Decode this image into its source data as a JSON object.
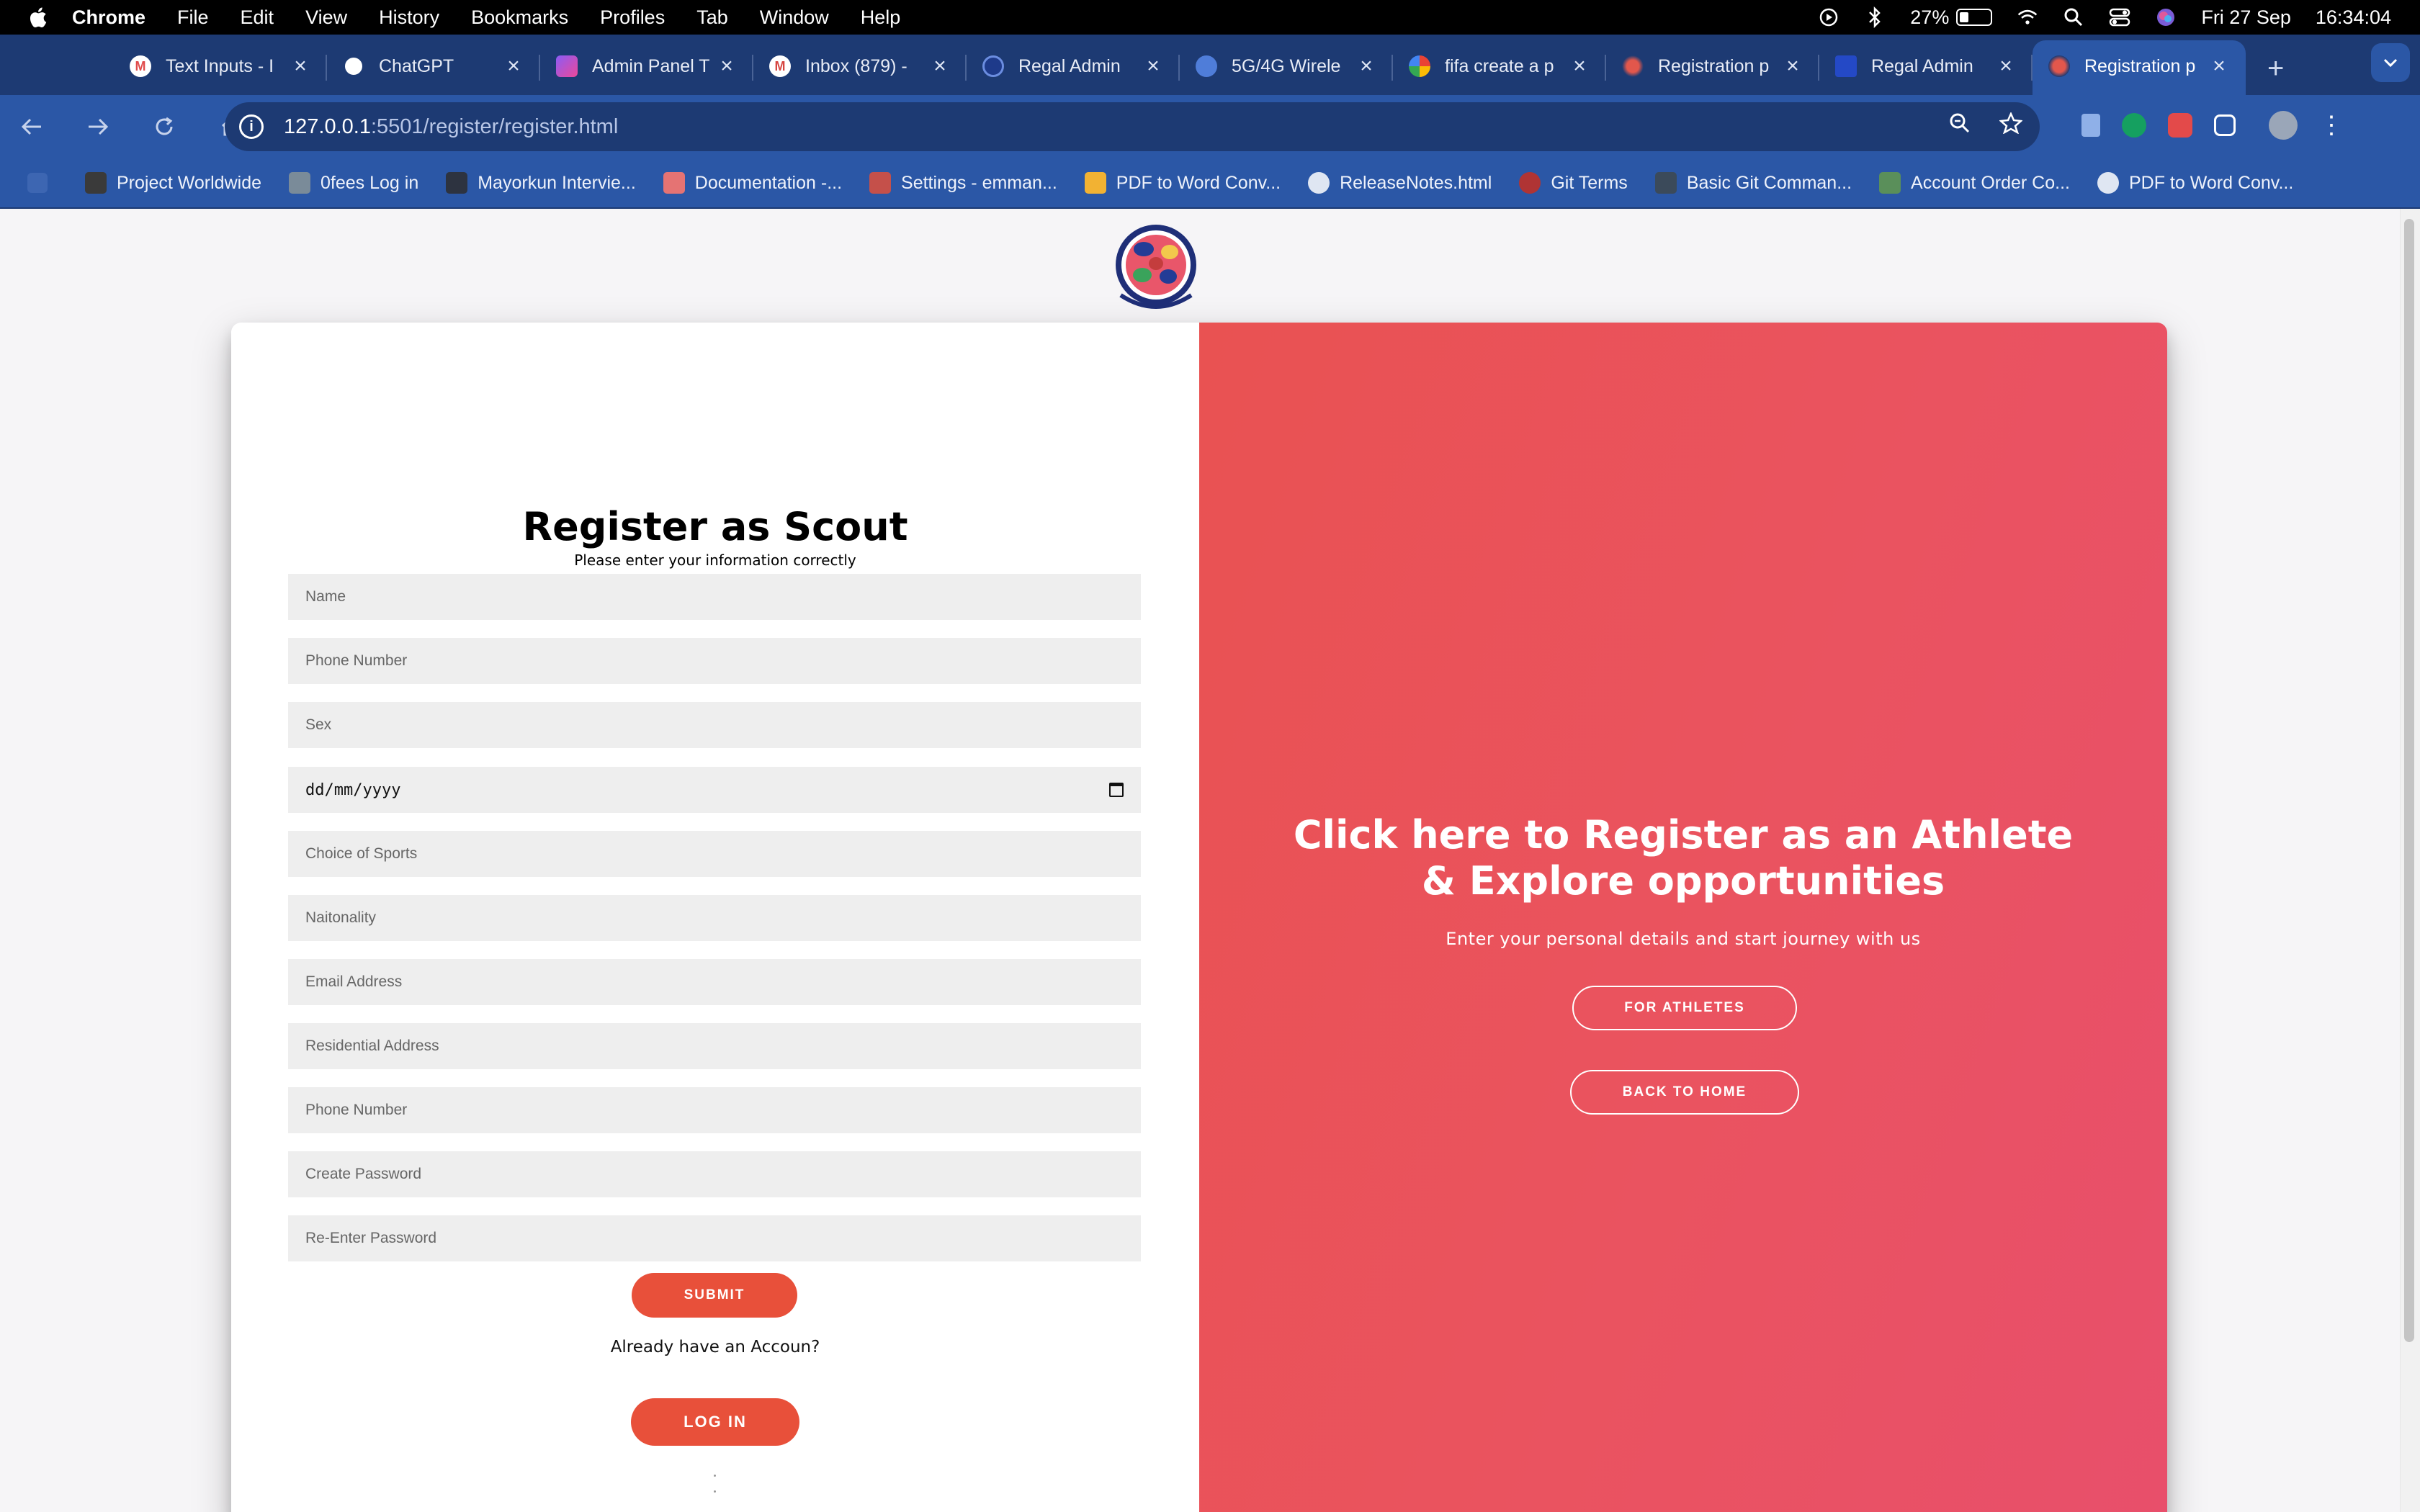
{
  "menubar": {
    "items": [
      "Chrome",
      "File",
      "Edit",
      "View",
      "History",
      "Bookmarks",
      "Profiles",
      "Tab",
      "Window",
      "Help"
    ],
    "battery": "27%",
    "date": "Fri 27 Sep",
    "time": "16:34:04"
  },
  "tabs": [
    {
      "title": "Text Inputs - I",
      "color": "#e04a4a"
    },
    {
      "title": "ChatGPT",
      "color": "#ffffff"
    },
    {
      "title": "Admin Panel T",
      "color": "#8b5cf6"
    },
    {
      "title": "Inbox (879) -",
      "color": "#d64541"
    },
    {
      "title": "Regal Admin",
      "color": "#1e3a8a"
    },
    {
      "title": "5G/4G Wirele",
      "color": "#4f7dd9"
    },
    {
      "title": "fifa create a p",
      "color": "#ffffff"
    },
    {
      "title": "Registration p",
      "color": "#e2574c"
    },
    {
      "title": "Regal Admin",
      "color": "#2449c6"
    },
    {
      "title": "Registration p",
      "color": "#e2574c"
    }
  ],
  "address": {
    "host": "127.0.0.1",
    "path": ":5501/register/register.html"
  },
  "bookmarks": [
    {
      "label": "Project Worldwide",
      "color": "#3a3a3a"
    },
    {
      "label": "0fees Log in",
      "color": "#7a8b99"
    },
    {
      "label": "Mayorkun Intervie...",
      "color": "#2d3340"
    },
    {
      "label": "Documentation -...",
      "color": "#e57373"
    },
    {
      "label": "Settings - emman...",
      "color": "#c5504a"
    },
    {
      "label": "PDF to Word Conv...",
      "color": "#f2b233"
    },
    {
      "label": "ReleaseNotes.html",
      "color": "#dfe6f2"
    },
    {
      "label": "Git Terms",
      "color": "#b03434"
    },
    {
      "label": "Basic Git Comman...",
      "color": "#3b4a5a"
    },
    {
      "label": "Account Order Co...",
      "color": "#5a8f5a"
    },
    {
      "label": "PDF to Word Conv...",
      "color": "#dfe6f2"
    }
  ],
  "form": {
    "title": "Register as Scout",
    "subtitle": "Please enter your information correctly",
    "fields": [
      "Name",
      "Phone Number",
      "Sex",
      "dd/mm/yyyy",
      "Choice of Sports",
      "Naitonality",
      "Email Address",
      "Residential Address",
      "Phone Number",
      "Create Password",
      "Re-Enter Password"
    ],
    "submit": "SUBMIT",
    "already": "Already have an Accoun?",
    "login": "LOG IN"
  },
  "overlay": {
    "title": "Click here to Register as an Athlete & Explore opportunities",
    "subtitle": "Enter your personal details and start journey with us",
    "athletes_button": "FOR ATHLETES",
    "home_button": "BACK TO HOME"
  },
  "colors": {
    "accent": "#e8503a",
    "overlay": "#ea5360",
    "chrome": "#2b57a6"
  }
}
